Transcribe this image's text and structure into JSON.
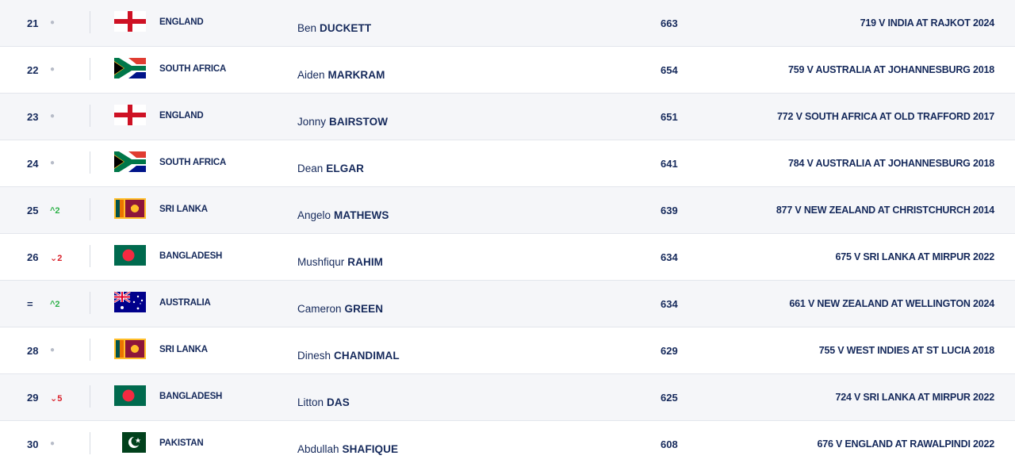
{
  "rows": [
    {
      "rank": "21",
      "move": "●",
      "move_type": "same",
      "flag": "england-flag",
      "country": "ENGLAND",
      "first": "Ben",
      "last": "DUCKETT",
      "rating": "663",
      "best": "719 V INDIA AT RAJKOT 2024"
    },
    {
      "rank": "22",
      "move": "●",
      "move_type": "same",
      "flag": "south-africa-flag",
      "country": "SOUTH AFRICA",
      "first": "Aiden",
      "last": "MARKRAM",
      "rating": "654",
      "best": "759 V AUSTRALIA AT JOHANNESBURG 2018"
    },
    {
      "rank": "23",
      "move": "●",
      "move_type": "same",
      "flag": "england-flag",
      "country": "ENGLAND",
      "first": "Jonny",
      "last": "BAIRSTOW",
      "rating": "651",
      "best": "772 V SOUTH AFRICA AT OLD TRAFFORD 2017"
    },
    {
      "rank": "24",
      "move": "●",
      "move_type": "same",
      "flag": "south-africa-flag",
      "country": "SOUTH AFRICA",
      "first": "Dean",
      "last": "ELGAR",
      "rating": "641",
      "best": "784 V AUSTRALIA AT JOHANNESBURG 2018"
    },
    {
      "rank": "25",
      "move": "^2",
      "move_type": "up",
      "flag": "sri-lanka-flag",
      "country": "SRI LANKA",
      "first": "Angelo",
      "last": "MATHEWS",
      "rating": "639",
      "best": "877 V NEW ZEALAND AT CHRISTCHURCH 2014"
    },
    {
      "rank": "26",
      "move": "⌄2",
      "move_type": "down",
      "flag": "bangladesh-flag",
      "country": "BANGLADESH",
      "first": "Mushfiqur",
      "last": "RAHIM",
      "rating": "634",
      "best": "675 V SRI LANKA AT MIRPUR 2022"
    },
    {
      "rank": "=",
      "move": "^2",
      "move_type": "up",
      "flag": "australia-flag",
      "country": "AUSTRALIA",
      "first": "Cameron",
      "last": "GREEN",
      "rating": "634",
      "best": "661 V NEW ZEALAND AT WELLINGTON 2024"
    },
    {
      "rank": "28",
      "move": "●",
      "move_type": "same",
      "flag": "sri-lanka-flag",
      "country": "SRI LANKA",
      "first": "Dinesh",
      "last": "CHANDIMAL",
      "rating": "629",
      "best": "755 V WEST INDIES AT ST LUCIA 2018"
    },
    {
      "rank": "29",
      "move": "⌄5",
      "move_type": "down",
      "flag": "bangladesh-flag",
      "country": "BANGLADESH",
      "first": "Litton",
      "last": "DAS",
      "rating": "625",
      "best": "724 V SRI LANKA AT MIRPUR 2022"
    },
    {
      "rank": "30",
      "move": "●",
      "move_type": "same",
      "flag": "pakistan-flag",
      "country": "PAKISTAN",
      "first": "Abdullah",
      "last": "SHAFIQUE",
      "rating": "608",
      "best": "676 V ENGLAND AT RAWALPINDI 2022"
    }
  ],
  "colors": {
    "text": "#15295b",
    "up": "#2fb24a",
    "down": "#d9202a",
    "same": "#b7bcc8",
    "alt_row": "#f5f6f9"
  }
}
